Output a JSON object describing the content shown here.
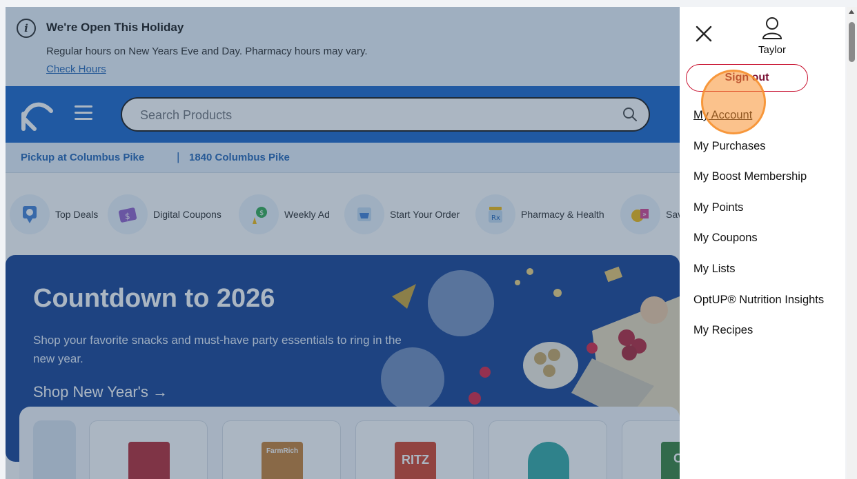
{
  "banner": {
    "title": "We're Open This Holiday",
    "text": "Regular hours on New Years Eve and Day. Pharmacy hours may vary.",
    "link": "Check Hours"
  },
  "search": {
    "placeholder": "Search Products"
  },
  "pickup": {
    "store": "Pickup at Columbus Pike",
    "separator": "|",
    "address": "1840 Columbus Pike"
  },
  "categories": [
    {
      "label": "Top Deals",
      "icon": "tag-icon"
    },
    {
      "label": "Digital Coupons",
      "icon": "coupon-icon"
    },
    {
      "label": "Weekly Ad",
      "icon": "weekly-ad-icon"
    },
    {
      "label": "Start Your Order",
      "icon": "cart-icon"
    },
    {
      "label": "Pharmacy & Health",
      "icon": "pharmacy-icon"
    },
    {
      "label": "Sav",
      "icon": "savings-icon"
    }
  ],
  "hero": {
    "title": "Countdown to 2026",
    "subtitle": "Shop your favorite snacks and must-have party essentials to ring in the new year.",
    "link": "Shop New Year's →"
  },
  "products": [
    {
      "brand": "",
      "color": "#b3202a"
    },
    {
      "brand": "FarmRich",
      "color": "#c57a2c"
    },
    {
      "brand": "RITZ",
      "color": "#d23a1f"
    },
    {
      "brand": "",
      "color": "#2aa6a0"
    },
    {
      "brand": "CL",
      "color": "#2f7d32"
    }
  ],
  "drawer": {
    "username": "Taylor",
    "signout": "Sign out",
    "menu": [
      "My Account",
      "My Purchases",
      "My Boost Membership",
      "My Points",
      "My Coupons",
      "My Lists",
      "OptUP® Nutrition Insights",
      "My Recipes"
    ]
  },
  "colors": {
    "brand_blue": "#1160c9",
    "signout_border": "#c8102e",
    "highlight": "#f78f2e"
  }
}
